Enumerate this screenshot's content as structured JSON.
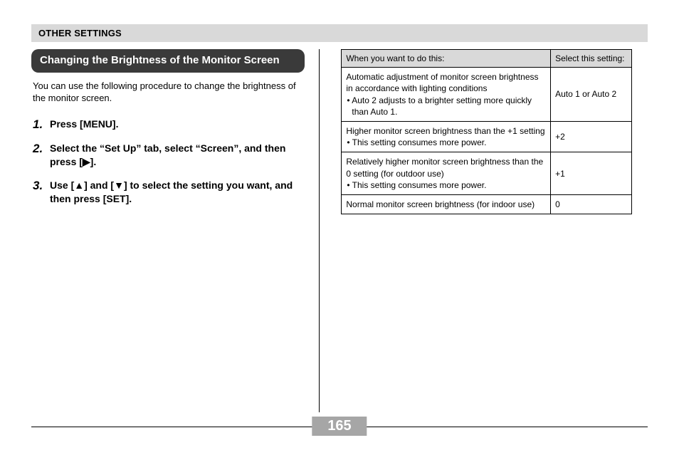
{
  "header": "OTHER SETTINGS",
  "section_title": "Changing the Brightness of the Monitor Screen",
  "intro": "You can use the following procedure to change the brightness of the monitor screen.",
  "steps": [
    {
      "num": "1.",
      "text": "Press [MENU]."
    },
    {
      "num": "2.",
      "text": "Select the “Set Up” tab, select “Screen”, and then press [▶]."
    },
    {
      "num": "3.",
      "text": "Use [▲] and [▼] to select the setting you want, and then press [SET]."
    }
  ],
  "table": {
    "head_left": "When you want to do this:",
    "head_right": "Select this setting:",
    "rows": [
      {
        "left_main": "Automatic adjustment of monitor screen brightness in accordance with lighting conditions",
        "left_bullet": "• Auto 2 adjusts to a brighter setting more quickly than Auto 1.",
        "right": "Auto 1 or Auto 2"
      },
      {
        "left_main": "Higher monitor screen brightness than the +1 setting",
        "left_bullet": "• This setting consumes more power.",
        "right": "+2"
      },
      {
        "left_main": "Relatively higher monitor screen brightness than the 0 setting (for outdoor use)",
        "left_bullet": "• This setting consumes more power.",
        "right": "+1"
      },
      {
        "left_main": "Normal monitor screen brightness (for indoor use)",
        "left_bullet": "",
        "right": "0"
      }
    ]
  },
  "page_number": "165"
}
